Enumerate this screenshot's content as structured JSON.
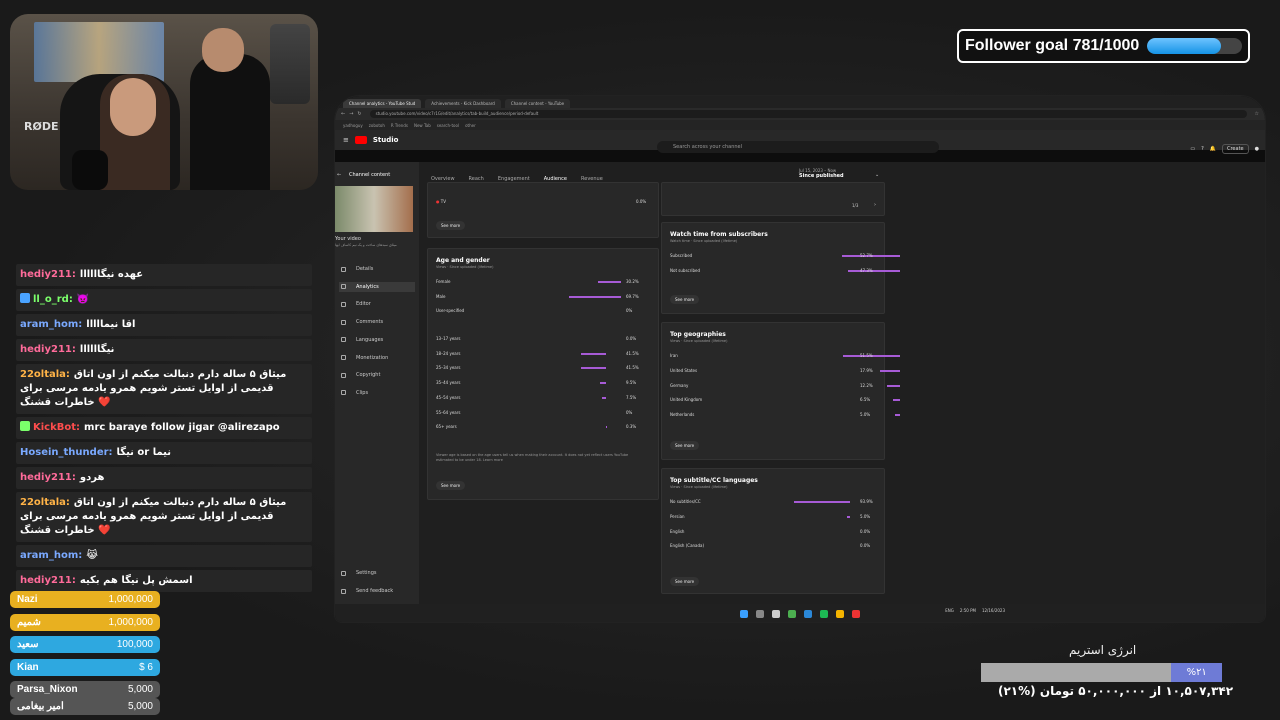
{
  "follower_goal": {
    "text": "Follower goal 781/1000",
    "progress": 0.78
  },
  "chat": [
    {
      "user": "hediy211:",
      "user_color": "#ff6b9a",
      "text": "عهده نیگاااااا",
      "icon": ""
    },
    {
      "user": "ll_o_rd:",
      "user_color": "#7bff6b",
      "text": "👿",
      "icon": "sword-icon"
    },
    {
      "user": "aram_hom:",
      "user_color": "#7aa9ff",
      "text": "اقا نیمااااا",
      "icon": ""
    },
    {
      "user": "hediy211:",
      "user_color": "#ff6b9a",
      "text": "نیگاااااا",
      "icon": ""
    },
    {
      "user": "22oltala:",
      "user_color": "#ffb347",
      "text": "میثاق ۵ ساله دارم دنبالت میکنم از اون اتاق قدیمی از اوایل تستر شویم همرو یادمه مرسی برای خاطرات قشنگ ❤️",
      "icon": ""
    },
    {
      "user": "KickBot:",
      "user_color": "#ff4d4d",
      "text": "mrc baraye follow jigar @alirezapo",
      "icon": "bot-icon"
    },
    {
      "user": "Hosein_thunder:",
      "user_color": "#7aa9ff",
      "text": "نیگا or نیما",
      "icon": ""
    },
    {
      "user": "hediy211:",
      "user_color": "#ff6b9a",
      "text": "هردو",
      "icon": ""
    },
    {
      "user": "22oltala:",
      "user_color": "#ffb347",
      "text": "میثاق ۵ ساله دارم دنبالت میکنم از اون اتاق قدیمی از اوایل تستر شویم همرو یادمه مرسی برای خاطرات قشنگ ❤️",
      "icon": ""
    },
    {
      "user": "aram_hom:",
      "user_color": "#7aa9ff",
      "text": "😹",
      "icon": ""
    },
    {
      "user": "hediy211:",
      "user_color": "#ff6b9a",
      "text": "اسمش پل نیگا هم بکیه",
      "icon": ""
    }
  ],
  "donations": [
    {
      "name": "Nazi",
      "amount": "1,000,000",
      "color": "#e8b020"
    },
    {
      "name": "شمیم",
      "amount": "1,000,000",
      "color": "#e8b020"
    },
    {
      "name": "سعید",
      "amount": "100,000",
      "color": "#2ea8e0"
    },
    {
      "name": "Kian",
      "amount": "$ 6",
      "color": "#2ea8e0"
    },
    {
      "name": "Parsa_Nixon",
      "amount": "5,000",
      "color": "#555555"
    },
    {
      "name": "امیر بیغامی",
      "amount": "5,000",
      "color": "#555555"
    }
  ],
  "energy": {
    "title": "انرژی استریم",
    "percent_label": "%۲۱",
    "progress": 0.21,
    "text": "۱۰,۵۰۷,۳۴۲ از ۵۰,۰۰۰,۰۰۰ تومان (%۲۱)"
  },
  "browser": {
    "tabs": [
      "Channel analytics - YouTube Stud",
      "Achievements - Kick Dashboard",
      "Channel content - YouTube"
    ],
    "url": "studio.youtube.com/video/c7r1G/edit/analytics/tab-build_audience/period-default",
    "bookmarks": [
      "yadhoguy",
      "zobotoh",
      "R Trends",
      "New Tab",
      "search-tool",
      "other"
    ]
  },
  "studio": {
    "logo": "Studio",
    "search_placeholder": "Search across your channel",
    "create": "Create",
    "channel_content": "Channel content",
    "your_video": "Your video",
    "video_title": "میثاق سبدهای ساخت و یک نیم کاساف ایها",
    "nav": [
      "Details",
      "Analytics",
      "Editor",
      "Comments",
      "Languages",
      "Monetization",
      "Copyright",
      "Clips"
    ],
    "nav_bottom": [
      "Settings",
      "Send feedback"
    ],
    "tabs": [
      "Overview",
      "Reach",
      "Engagement",
      "Audience",
      "Revenue"
    ],
    "active_tab": "Audience",
    "date_range": "Jul 15, 2023 – Now",
    "date_label": "Since published",
    "device_top": {
      "label": "TV",
      "value": "0.0%"
    },
    "see_more": "See more",
    "pager": "1/3",
    "age_gender": {
      "title": "Age and gender",
      "sub": "Views · Since uploaded (lifetime)",
      "gender": [
        {
          "label": "Female",
          "value": "30.2%",
          "pct": 30.2
        },
        {
          "label": "Male",
          "value": "69.7%",
          "pct": 69.7
        },
        {
          "label": "User-specified",
          "value": "0%",
          "pct": 0
        }
      ],
      "ages": [
        {
          "label": "13–17 years",
          "value": "0.0%",
          "pct": 0
        },
        {
          "label": "18–24 years",
          "value": "41.5%",
          "pct": 41.5
        },
        {
          "label": "25–34 years",
          "value": "41.5%",
          "pct": 41.5
        },
        {
          "label": "35–44 years",
          "value": "9.5%",
          "pct": 9.5
        },
        {
          "label": "45–54 years",
          "value": "7.5%",
          "pct": 7.5
        },
        {
          "label": "55–64 years",
          "value": "0%",
          "pct": 0
        },
        {
          "label": "65+ years",
          "value": "0.3%",
          "pct": 0.3
        }
      ],
      "note": "Viewer age is based on the age users tell us when making their account. It does not yet reflect users YouTube estimated to be under 18. Learn more"
    },
    "subscribers": {
      "title": "Watch time from subscribers",
      "sub": "Watch time · Since uploaded (lifetime)",
      "rows": [
        {
          "label": "Subscribed",
          "value": "52.7%",
          "pct": 52.7
        },
        {
          "label": "Not subscribed",
          "value": "47.3%",
          "pct": 47.3
        }
      ]
    },
    "geographies": {
      "title": "Top geographies",
      "sub": "Views · Since uploaded (lifetime)",
      "rows": [
        {
          "label": "Iran",
          "value": "51.5%",
          "pct": 51.5
        },
        {
          "label": "United States",
          "value": "17.9%",
          "pct": 17.9
        },
        {
          "label": "Germany",
          "value": "12.2%",
          "pct": 12.2
        },
        {
          "label": "United Kingdom",
          "value": "6.5%",
          "pct": 6.5
        },
        {
          "label": "Netherlands",
          "value": "5.0%",
          "pct": 5.0
        }
      ]
    },
    "subtitles": {
      "title": "Top subtitle/CC languages",
      "sub": "Views · Since uploaded (lifetime)",
      "rows": [
        {
          "label": "No subtitles/CC",
          "value": "93.9%",
          "pct": 93.9
        },
        {
          "label": "Persian",
          "value": "5.0%",
          "pct": 5.0
        },
        {
          "label": "English",
          "value": "0.0%",
          "pct": 0.0
        },
        {
          "label": "English (Canada)",
          "value": "0.0%",
          "pct": 0.0
        }
      ]
    },
    "taskbar_time": "2:50 PM",
    "taskbar_date": "12/16/2023",
    "taskbar_lang": "ENG"
  }
}
